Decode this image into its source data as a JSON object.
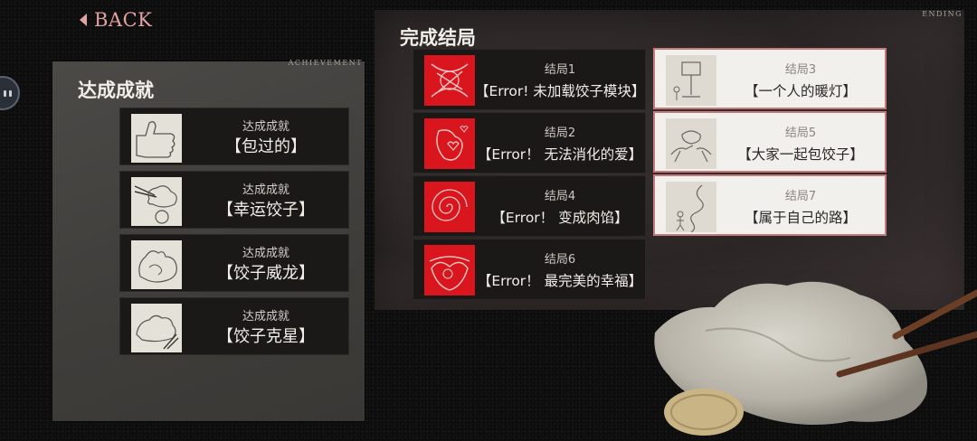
{
  "nav": {
    "back_label": "BACK"
  },
  "achievements": {
    "tag": "ACHIEVEMENT",
    "title": "达成成就",
    "items": [
      {
        "caption": "达成成就",
        "name": "【包过的】",
        "icon": "thumbs-up-sketch-icon"
      },
      {
        "caption": "达成成就",
        "name": "【幸运饺子】",
        "icon": "dumpling-chopsticks-sketch-icon"
      },
      {
        "caption": "达成成就",
        "name": "【饺子威龙】",
        "icon": "muscle-arm-sketch-icon"
      },
      {
        "caption": "达成成就",
        "name": "【饺子克星】",
        "icon": "crushed-dumpling-sketch-icon"
      }
    ]
  },
  "endings": {
    "tag": "ENDING",
    "title": "完成结局",
    "items": [
      {
        "caption": "结局1",
        "name": "【Error! 未加载饺子模块】",
        "style": "error",
        "icon": "glitch-doodle-icon"
      },
      {
        "caption": "结局3",
        "name": "【一个人的暖灯】",
        "style": "normal",
        "icon": "lamp-sketch-icon"
      },
      {
        "caption": "结局2",
        "name": "【Error！ 无法消化的爱】",
        "style": "error",
        "icon": "hearts-doodle-icon"
      },
      {
        "caption": "结局5",
        "name": "【大家一起包饺子】",
        "style": "normal",
        "icon": "hands-sketch-icon"
      },
      {
        "caption": "结局4",
        "name": "【Error！ 变成肉馅】",
        "style": "error",
        "icon": "spiral-doodle-icon"
      },
      {
        "caption": "结局7",
        "name": "【属于自己的路】",
        "style": "normal",
        "icon": "path-sketch-icon"
      },
      {
        "caption": "结局6",
        "name": "【Error！ 最完美的幸福】",
        "style": "error",
        "icon": "heart-face-doodle-icon"
      }
    ]
  },
  "colors": {
    "accent": "#e3a2a2",
    "error_red": "#d9161d",
    "normal_border": "#c27a7a"
  }
}
